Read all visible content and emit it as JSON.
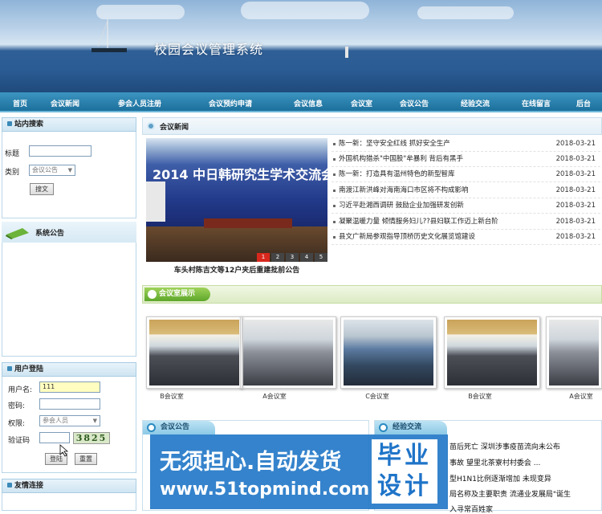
{
  "site": {
    "title": "校园会议管理系统"
  },
  "nav": {
    "items": [
      "首页",
      "会议新闻",
      "参会人员注册",
      "会议预约申请",
      "会议信息",
      "会议室",
      "会议公告",
      "经验交流",
      "在线留言",
      "后台"
    ]
  },
  "search": {
    "title": "站内搜索",
    "title_label": "标题",
    "type_label": "类别",
    "type_value": "会议公告",
    "button": "搜文"
  },
  "notice": {
    "title": "系统公告"
  },
  "login": {
    "title": "用户登陆",
    "user_label": "用户名:",
    "user_value": "111",
    "pass_label": "密码:",
    "pass_value": "",
    "role_label": "权限:",
    "role_value": "参会人员",
    "captcha_label": "验证码",
    "captcha_code": "3825",
    "login_btn": "登陆",
    "reset_btn": "重置"
  },
  "links": {
    "title": "友情连接"
  },
  "news": {
    "title": "会议新闻",
    "photo_headline": "2014 中日韩研究生学术交流会",
    "photo_caption": "车头村陈吉文等12户夹后重建批前公告",
    "pager": [
      "1",
      "2",
      "3",
      "4",
      "5"
    ],
    "items": [
      {
        "title": "陈一新：坚守安全红线 抓好安全生产",
        "date": "2018-03-21"
      },
      {
        "title": "外国机构猎杀\"中国股\"牟暴利 背后有黑手",
        "date": "2018-03-21"
      },
      {
        "title": "陈一新：打造具有温州特色的新型智库",
        "date": "2018-03-21"
      },
      {
        "title": "南渡江新洪峰对海南海口市区将不构成影响",
        "date": "2018-03-21"
      },
      {
        "title": "习近平赴湘西调研 鼓励企业加强研发创新",
        "date": "2018-03-21"
      },
      {
        "title": "凝聚温暖力量 倾情服务妇儿??县妇联工作迈上新台阶",
        "date": "2018-03-21"
      },
      {
        "title": "县文广新局参观指导顶桥历史文化展览馆建设",
        "date": "2018-03-21"
      }
    ]
  },
  "rooms": {
    "title": "会议室展示",
    "captions": [
      "B会议室",
      "A会议室",
      "C会议室",
      "B会议室",
      "A会议室"
    ]
  },
  "announce": {
    "title": "会议公告"
  },
  "exchange": {
    "title": "经验交流",
    "items": [
      "苗后死亡 深圳涉事疫苗流向未公布",
      "事故 望里北茶寮村村委会 ...",
      "型H1N1比例逐渐增加 未现变异",
      "局名称及主要职责 流通业发展局\"诞生",
      "入寻常百姓家"
    ]
  },
  "ad": {
    "line1": "无须担心.自动发货",
    "line2": "www.51topmind.com",
    "badge": "毕业设计"
  }
}
